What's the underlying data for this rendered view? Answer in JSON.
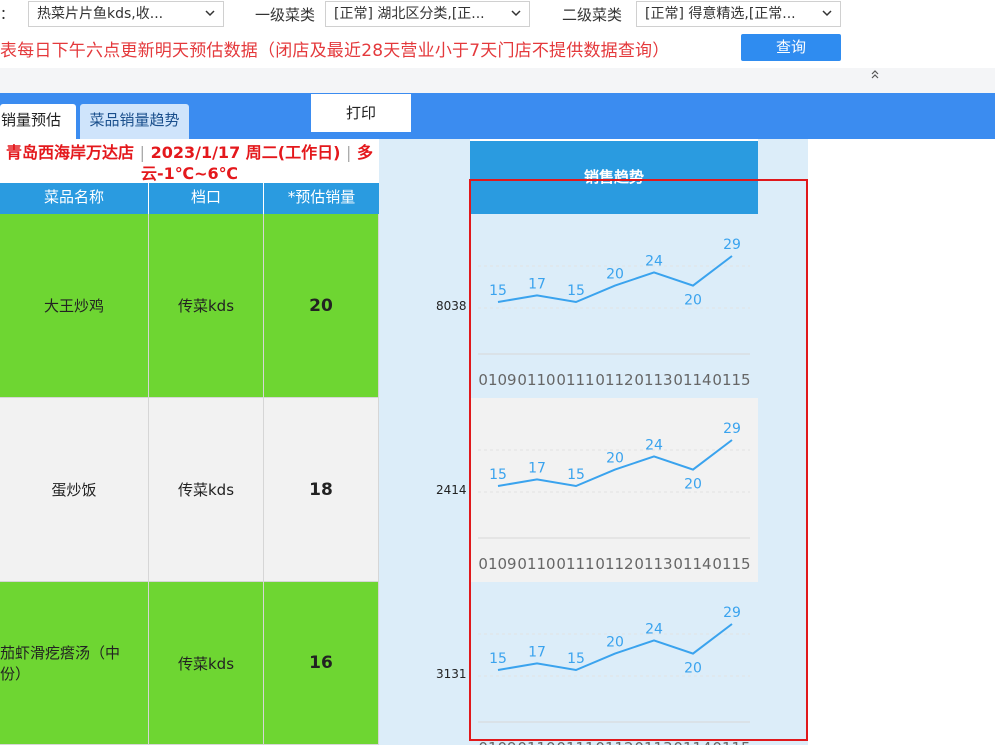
{
  "filters": {
    "colon": "：",
    "kds_select": "热菜片片鱼kds,收...",
    "level1_label": "一级菜类",
    "level1_select": "[正常] 湖北区分类,[正...",
    "level2_label": "二级菜类",
    "level2_select": "[正常] 得意精选,[正常...",
    "notice": "表每日下午六点更新明天预估数据（闭店及最近28天营业小于7天门店不提供数据查询）",
    "query_button": "查询"
  },
  "tabs": {
    "active": "品销量预估",
    "second": "菜品销量趋势",
    "print": "打印"
  },
  "store": {
    "name": "青岛西海岸万达店",
    "date": "2023/1/17 周二(工作日)",
    "weather_part1": "多",
    "weather_part2": "云-1℃~6℃",
    "sep": "|"
  },
  "table": {
    "headers": [
      "菜品名称",
      "档口",
      "*预估销量"
    ],
    "trend_header": "销售趋势",
    "rows": [
      {
        "name": "大王炒鸡",
        "station": "传菜kds",
        "qty": "20",
        "code": "8038"
      },
      {
        "name": "蛋炒饭",
        "station": "传菜kds",
        "qty": "18",
        "code": "2414"
      },
      {
        "name": "茄虾滑疙瘩汤（中份）",
        "station": "传菜kds",
        "qty": "16",
        "code": "3131"
      }
    ]
  },
  "colors": {
    "accent_blue": "#3b8cf0",
    "header_blue": "#2a9be0",
    "row_green": "#6ed632",
    "notice_red": "#e4393c",
    "line_blue": "#3aa3ee",
    "highlight_red": "#e0181b"
  },
  "chart_data": {
    "type": "line",
    "categories": [
      "0109",
      "0110",
      "0111",
      "0112",
      "0113",
      "0114",
      "0115"
    ],
    "series": [
      {
        "values": [
          15,
          17,
          15,
          20,
          24,
          20,
          29
        ]
      }
    ],
    "repeat_rows": 3
  }
}
